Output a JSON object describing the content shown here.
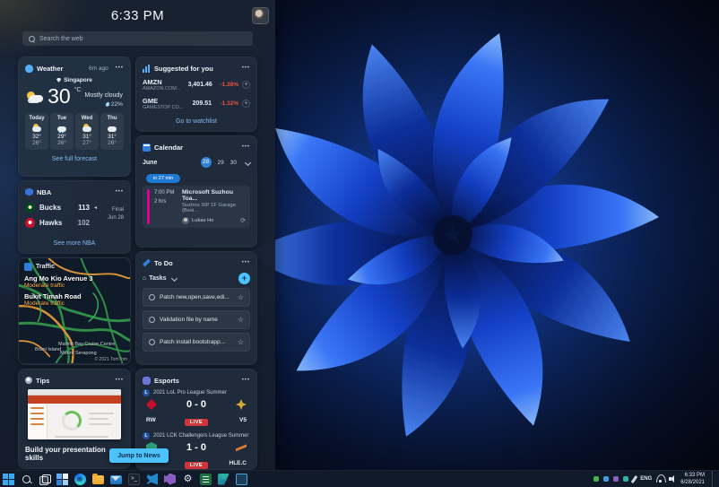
{
  "accent_colors": {
    "button_blue": "#4cc2ff",
    "link_blue": "#86b9ec",
    "negative_red": "#e8543f",
    "live_red": "#d13438",
    "event_magenta": "#e3008c"
  },
  "panel": {
    "time": "6:33 PM",
    "search": {
      "placeholder": "Search the web"
    },
    "weather": {
      "title": "Weather",
      "updated": "6m ago",
      "location": "Singapore",
      "temp": "30",
      "unit": "°C",
      "condition": "Mostly cloudy",
      "precip": "22%",
      "forecast": [
        {
          "day": "Today",
          "hi": "32°",
          "lo": "26°",
          "icon": "partly-sunny"
        },
        {
          "day": "Tue",
          "hi": "29°",
          "lo": "26°",
          "icon": "rain"
        },
        {
          "day": "Wed",
          "hi": "31°",
          "lo": "27°",
          "icon": "partly-sunny"
        },
        {
          "day": "Thu",
          "hi": "31°",
          "lo": "26°",
          "icon": "cloudy"
        }
      ],
      "link": "See full forecast"
    },
    "stocks": {
      "title": "Suggested for you",
      "items": [
        {
          "symbol": "AMZN",
          "company": "AMAZON.COM...",
          "price": "3,401.46",
          "change": "-1.38%"
        },
        {
          "symbol": "GME",
          "company": "GAMESTOP CO...",
          "price": "209.51",
          "change": "-1.32%"
        }
      ],
      "link": "Go to watchlist"
    },
    "nba": {
      "title": "NBA",
      "teams": [
        {
          "name": "Bucks",
          "score": "113"
        },
        {
          "name": "Hawks",
          "score": "102"
        }
      ],
      "status": "Final",
      "date": "Jun 28",
      "link": "See more NBA"
    },
    "calendar": {
      "title": "Calendar",
      "month": "June",
      "dates": [
        "28",
        "29",
        "30"
      ],
      "selected_date": "28",
      "countdown": "in 27 min",
      "event": {
        "time": "7:00 PM",
        "duration": "2 hrs",
        "name": "Microsoft Suzhou Toa...",
        "location": "Suzhou SIP 1F Garage (Besi...",
        "attendee": "Lukas Ho"
      }
    },
    "traffic": {
      "title": "Traffic",
      "roads": [
        {
          "name": "Ang Mo Kio Avenue 3",
          "status": "Moderate traffic"
        },
        {
          "name": "Bukit Timah Road",
          "status": "Moderate traffic"
        }
      ],
      "map_labels": [
        "Brani Island",
        "Marina Bay Cruise Centre",
        "Mount Serapong"
      ],
      "copyright": "© 2021 TomTom"
    },
    "todo": {
      "title": "To Do",
      "list_name": "Tasks",
      "items": [
        {
          "text": "Patch new,open,save,edi..."
        },
        {
          "text": "Validation file by name"
        },
        {
          "text": "Patch install bootstrapp..."
        }
      ]
    },
    "tips": {
      "title": "Tips",
      "caption": "Build your presentation skills"
    },
    "esports": {
      "title": "Esports",
      "matches": [
        {
          "league": "2021 LoL Pro League Summer",
          "home": "RW",
          "score": "0 - 0",
          "away": "V5",
          "status": "LIVE"
        },
        {
          "league": "2021 LCK Challengers League Summer",
          "home": "",
          "score": "1 - 0",
          "away": "HLE.C",
          "status": "LIVE"
        }
      ]
    },
    "jump_button": "Jump to News"
  },
  "taskbar": {
    "icons": [
      "start-icon",
      "search-icon",
      "task-view-icon",
      "widgets-icon",
      "edge-icon",
      "file-explorer-icon",
      "mail-icon",
      "terminal-icon",
      "vscode-icon",
      "visual-studio-icon",
      "settings-gear-icon",
      "excel-icon",
      "power-automate-icon",
      "virtual-machine-icon"
    ],
    "terminal_glyph": ">_",
    "settings_glyph": "⚙",
    "tray": {
      "language": "ENG",
      "time": "6:33 PM",
      "date": "6/28/2021"
    }
  }
}
